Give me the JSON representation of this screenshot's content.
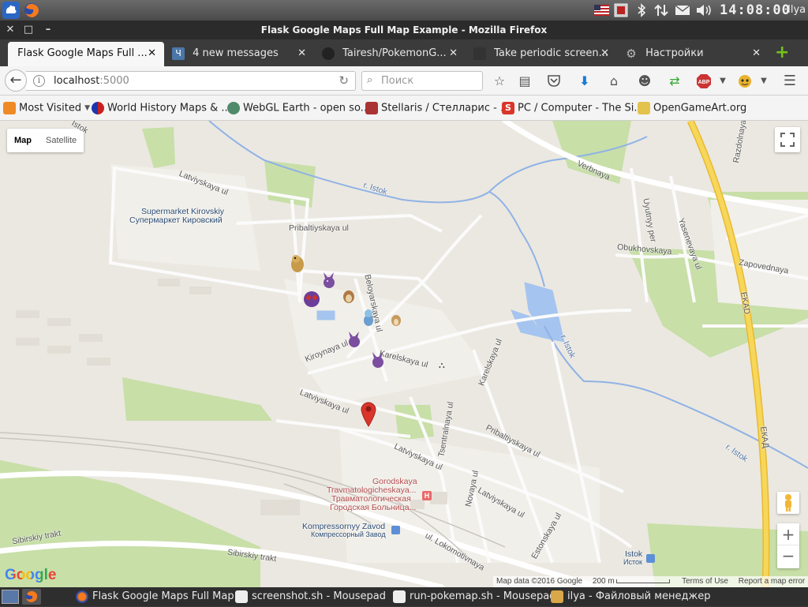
{
  "desktop": {
    "clock": "14:08:00",
    "user": "Ilya"
  },
  "window": {
    "title": "Flask Google Maps Full Map Example - Mozilla Firefox"
  },
  "tabs": [
    {
      "label": "Flask Google Maps Full ...",
      "active": true
    },
    {
      "label": "4 new messages",
      "active": false
    },
    {
      "label": "Tairesh/PokemonG...",
      "active": false
    },
    {
      "label": "Take periodic screen...",
      "active": false
    },
    {
      "label": "Настройки",
      "active": false
    }
  ],
  "navbar": {
    "url_host": "localhost",
    "url_port": ":5000",
    "search_placeholder": "Поиск"
  },
  "bookmarks": [
    {
      "label": "Most Visited"
    },
    {
      "label": "World History Maps & ..."
    },
    {
      "label": "WebGL Earth - open so..."
    },
    {
      "label": "Stellaris / Стелларис - ..."
    },
    {
      "label": "PC / Computer - The Si..."
    },
    {
      "label": "OpenGameArt.org"
    }
  ],
  "map": {
    "type_map": "Map",
    "type_satellite": "Satellite",
    "labels": {
      "istok_top": "Istok",
      "latviyskaya1": "Latviyskaya ul",
      "supermarket_lat": "Supermarket Kirovskiy",
      "supermarket_cyr": "Супермаркет Кировский",
      "pribaltiyskaya1": "Pribaltiyskaya ul",
      "r_istok1": "r. Istok",
      "verbnaya": "Verbnaya",
      "uyutnyy": "Uyutnyy per",
      "razdolnaya": "Razdolnaya",
      "obukhovskaya": "Obukhovskaya",
      "yasenevaya": "Yasenevaya ul",
      "zapovednaya": "Zapovednaya",
      "ekad1": "EKAD",
      "beloyarskaya": "Beloyarskaya ul",
      "r_istok2": "r. Istok",
      "kiroynaya": "Kiroynaya ul",
      "karelskaya1": "Karelskaya ul",
      "karelskaya2": "Karelskaya ul",
      "latviyskaya2": "Latviyskaya ul",
      "tsentralnaya": "Tsentralnaya ul",
      "pribaltiyskaya2": "Pribaltiyskaya ul",
      "latviyskaya3": "Latviyskaya ul",
      "ekad2": "ЕКАД",
      "r_istok3": "r. Istok",
      "gorodskaya1": "Gorodskaya",
      "gorodskaya2": "Travmatologicheskaya...",
      "gorodskaya3": "Травматологическая",
      "gorodskaya4": "Городская Больница...",
      "novaya": "Novaya ul",
      "latviyskaya4": "Latviyskaya ul",
      "kompressor_lat": "Kompressornyy Zavod",
      "kompressor_cyr": "Компрессорный Завод",
      "estonskaya": "Estonskaya ul",
      "lokomotivnaya": "ul. Lokomotivnaya",
      "sibirskiy1": "Sibirskiy trakt",
      "sibirskiy2": "Sibirskiy trakt",
      "istok_station_lat": "Istok",
      "istok_station_cyr": "Исток",
      "hospital_h": "H"
    },
    "footer": {
      "data": "Map data ©2016 Google",
      "scale": "200 m",
      "terms": "Terms of Use",
      "report": "Report a map error",
      "google": "Google"
    }
  },
  "taskbar": [
    {
      "label": "Flask Google Maps Full Map..."
    },
    {
      "label": "screenshot.sh - Mousepad"
    },
    {
      "label": "run-pokemap.sh - Mousepad"
    },
    {
      "label": "ilya - Файловый менеджер"
    }
  ],
  "colors": {
    "map_bg": "#ebe8e1",
    "park": "#c8dfa8",
    "water": "#a5c4ef",
    "road": "#ffffff",
    "highway": "#f5cd4a",
    "marker": "#d9352b"
  }
}
